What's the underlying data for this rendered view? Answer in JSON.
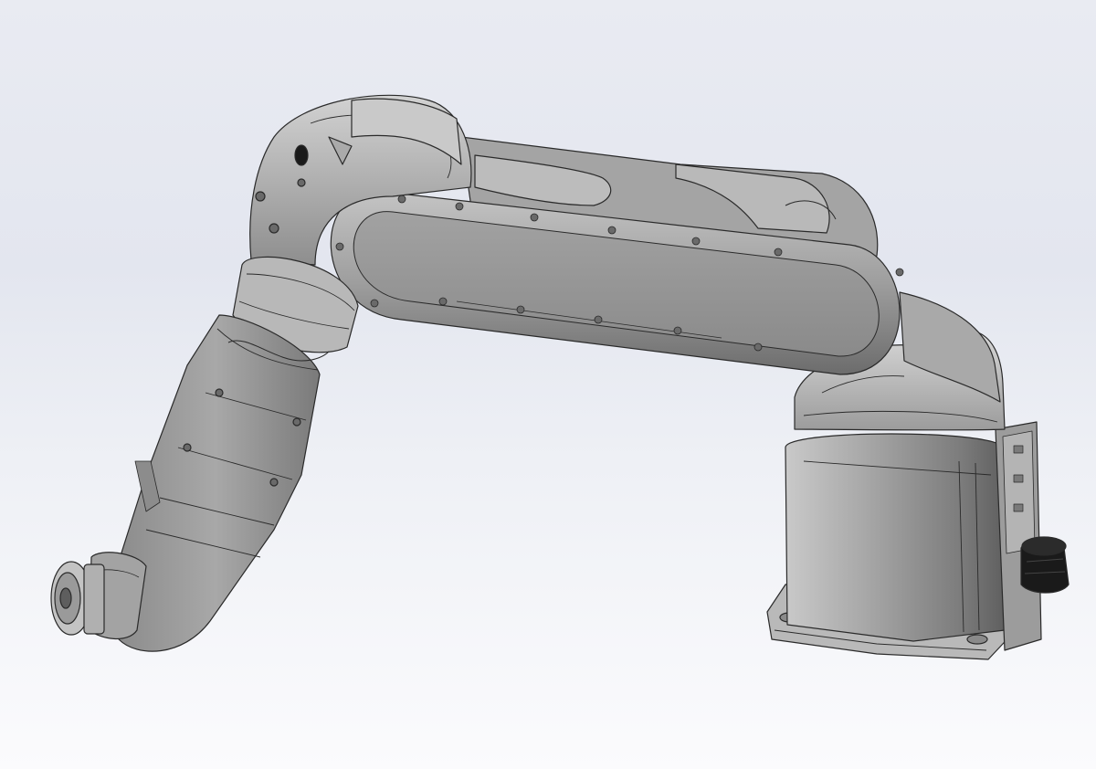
{
  "viewport": {
    "background_top": "#e3e6ef",
    "background_bottom": "#fbfbfd"
  },
  "model": {
    "body_color": "#9a9a9a",
    "highlight_color": "#d6d6d6",
    "shadow_color": "#5e5e5e",
    "edge_color": "#2a2a2a",
    "connector_color": "#151515"
  },
  "icons": [
    "flange-icon",
    "connector-icon"
  ]
}
